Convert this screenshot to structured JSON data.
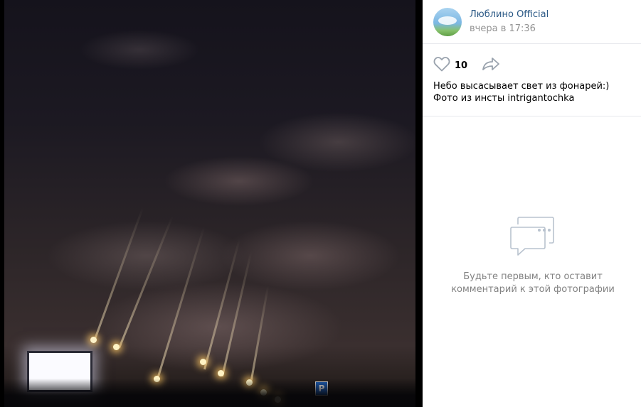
{
  "post": {
    "author": "Люблино Official",
    "date": "вчера в 17:36",
    "like_count": "10",
    "description_line1": "Небо высасывает свет из фонарей:)",
    "description_line2": "Фото из инсты intrigantochka"
  },
  "comments": {
    "empty_line1": "Будьте первым, кто оставит",
    "empty_line2": "комментарий к этой фотографии"
  },
  "photo": {
    "parking_sign": "P"
  },
  "icons": {
    "like": "heart-icon",
    "share": "share-arrow-icon",
    "empty_comments": "comments-bubble-icon"
  },
  "colors": {
    "link": "#2a5885",
    "muted": "#939393",
    "divider": "#e7e8ec",
    "icon": "#99a2ad"
  }
}
